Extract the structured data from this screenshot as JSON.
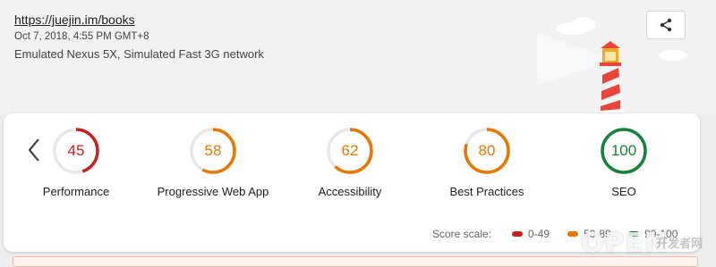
{
  "header": {
    "url": "https://juejin.im/books",
    "date": "Oct 7, 2018, 4:55 PM GMT+8",
    "environment": "Emulated Nexus 5X, Simulated Fast 3G network"
  },
  "categories": [
    {
      "label": "Performance",
      "score": "45",
      "value": 45,
      "color": "#c7221f"
    },
    {
      "label": "Progressive Web App",
      "score": "58",
      "value": 58,
      "color": "#e67700"
    },
    {
      "label": "Accessibility",
      "score": "62",
      "value": 62,
      "color": "#e67700"
    },
    {
      "label": "Best Practices",
      "score": "80",
      "value": 80,
      "color": "#e67700"
    },
    {
      "label": "SEO",
      "score": "100",
      "value": 100,
      "color": "#178239"
    }
  ],
  "score_scale": {
    "title": "Score scale:",
    "ranges": [
      {
        "label": "0-49",
        "color": "#c7221f"
      },
      {
        "label": "50-89",
        "color": "#e67700"
      },
      {
        "label": "90-100",
        "color": "#178239"
      }
    ]
  },
  "icons": {
    "share": "share-icon",
    "back": "chevron-left-icon",
    "logo": "lighthouse-icon"
  },
  "watermark": {
    "brand": "OPEN",
    "sub": "开发者网"
  }
}
